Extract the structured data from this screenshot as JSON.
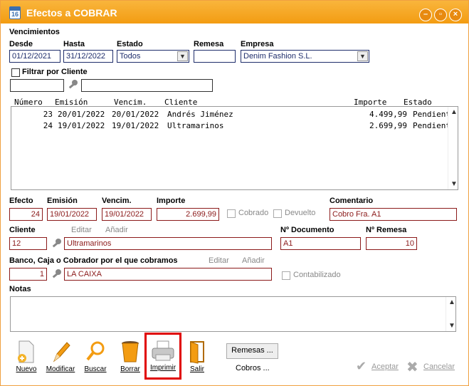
{
  "window": {
    "title": "Efectos a COBRAR",
    "icon": "calendar-icon"
  },
  "vencimientos": {
    "section_label": "Vencimientos",
    "desde_label": "Desde",
    "desde_value": "01/12/2021",
    "hasta_label": "Hasta",
    "hasta_value": "31/12/2022",
    "estado_label": "Estado",
    "estado_value": "Todos",
    "remesa_label": "Remesa",
    "remesa_value": "",
    "empresa_label": "Empresa",
    "empresa_value": "Denim Fashion S.L."
  },
  "filtro": {
    "label": "Filtrar por Cliente",
    "code_value": "",
    "name_value": ""
  },
  "table": {
    "headers": {
      "numero": "Número",
      "emision": "Emisión",
      "vencim": "Vencim.",
      "cliente": "Cliente",
      "importe": "Importe",
      "estado": "Estado"
    },
    "rows": [
      {
        "numero": "23",
        "emision": "20/01/2022",
        "vencim": "20/01/2022",
        "cliente": "Andrés Jiménez",
        "importe": "4.499,99",
        "estado": "Pendiente"
      },
      {
        "numero": "24",
        "emision": "19/01/2022",
        "vencim": "19/01/2022",
        "cliente": "Ultramarinos",
        "importe": "2.699,99",
        "estado": "Pendiente"
      }
    ]
  },
  "detail": {
    "efecto_label": "Efecto",
    "efecto_value": "24",
    "emision_label": "Emisión",
    "emision_value": "19/01/2022",
    "vencim_label": "Vencim.",
    "vencim_value": "19/01/2022",
    "importe_label": "Importe",
    "importe_value": "2.699,99",
    "cobrado_label": "Cobrado",
    "devuelto_label": "Devuelto",
    "comentario_label": "Comentario",
    "comentario_value": "Cobro Fra. A1",
    "cliente_label": "Cliente",
    "cliente_code": "12",
    "cliente_name": "Ultramarinos",
    "editar_label": "Editar",
    "anadir_label": "Añadir",
    "documento_label": "Nº Documento",
    "documento_value": "A1",
    "remesa_label": "Nº Remesa",
    "remesa_value": "10",
    "banco_label": "Banco, Caja o Cobrador por el que cobramos",
    "banco_code": "1",
    "banco_name": "LA CAIXA",
    "contabilizado_label": "Contabilizado",
    "notas_label": "Notas"
  },
  "toolbar": {
    "nuevo": "Nuevo",
    "modificar": "Modificar",
    "buscar": "Buscar",
    "borrar": "Borrar",
    "imprimir": "Imprimir",
    "salir": "Salir",
    "remesas": "Remesas ...",
    "cobros": "Cobros ...",
    "aceptar": "Aceptar",
    "cancelar": "Cancelar"
  },
  "colors": {
    "title_bar": "#f39c12",
    "field_border_red": "#8b1a1a",
    "field_border_blue": "#1e2d6b",
    "highlight": "#e00000"
  }
}
